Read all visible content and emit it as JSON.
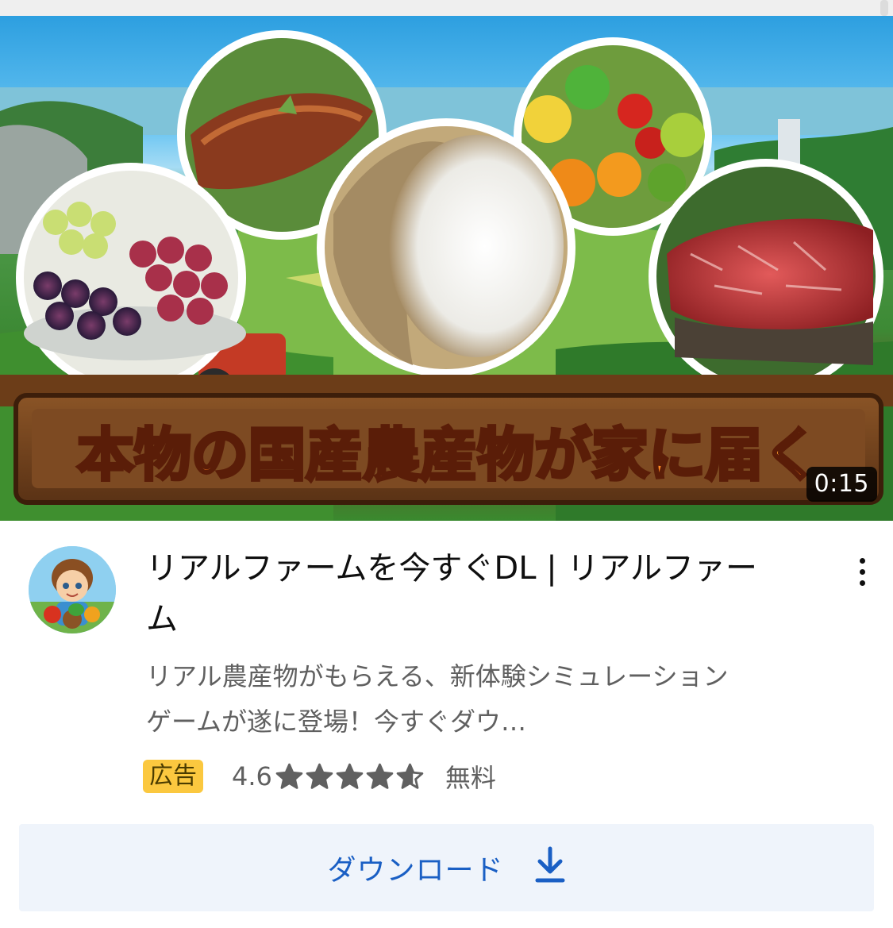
{
  "video": {
    "banner_text": "本物の国産農産物が家に届く",
    "duration": "0:15"
  },
  "ad": {
    "title": "リアルファームを今すぐDL | リアルファーム",
    "description": "リアル農産物がもらえる、新体験シミュレーションゲームが遂に登場！今すぐダウ…",
    "badge": "広告",
    "rating": "4.6",
    "rating_value": 4.6,
    "rating_max": 5,
    "price": "無料",
    "cta_label": "ダウンロード"
  },
  "icons": {
    "menu": "more-vert-icon",
    "download": "download-icon",
    "star": "star-icon"
  },
  "colors": {
    "badge_bg": "#fbc83f",
    "cta_text": "#1a5fc4",
    "cta_bg": "#eff4fb",
    "star": "#606060"
  }
}
